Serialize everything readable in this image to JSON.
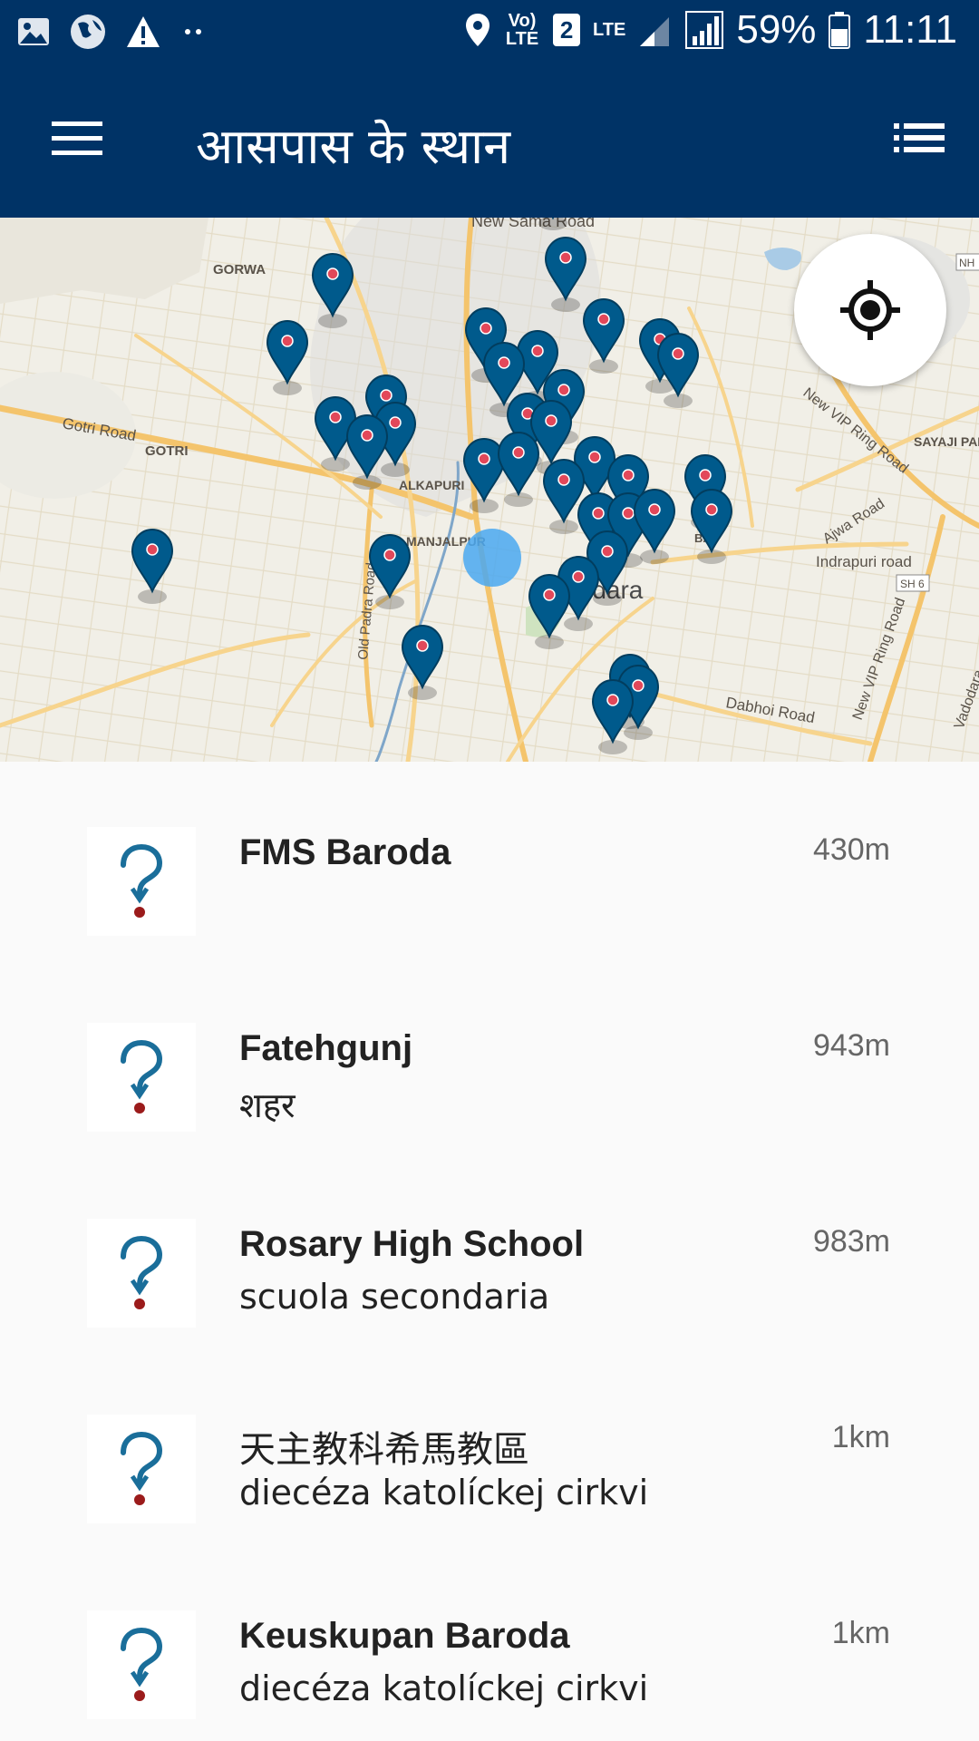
{
  "status_bar": {
    "battery": "59%",
    "time": "11:11",
    "volte": "Vo) LTE",
    "sim": "2",
    "lte": "LTE",
    "notifications": [
      "gallery-icon",
      "globe-icon",
      "warning-icon",
      "more-dots-icon"
    ],
    "indicators": [
      "location-icon",
      "volte-icon",
      "sim2-icon",
      "data-arrows-icon",
      "signal-icon",
      "signal-icon",
      "battery-icon"
    ]
  },
  "app_bar": {
    "title": "आसपास के स्थान",
    "menu_icon": "hamburger-menu-icon",
    "list_icon": "list-view-icon"
  },
  "map": {
    "locate_icon": "my-location-icon",
    "pin_color": "#005a8c",
    "pin_dot_color": "#e2485a",
    "labels": [
      "New Sama Road",
      "GORWA",
      "Gotri Road",
      "GOTRI",
      "ALKAPURI",
      "MANJALPUR",
      "Old Padra Road",
      "Vadodara",
      "New VIP Ring Road",
      "SAYAJI PARK",
      "Ajwa Road",
      "Indrapuri road",
      "SH 6",
      "New VIP Ring Road",
      "Dabhoi Road",
      "Vadodara",
      "NH",
      "BA"
    ]
  },
  "places": [
    {
      "name": "FMS Baroda",
      "description": "",
      "distance": "430m",
      "icon": "unknown-place-question-icon"
    },
    {
      "name": "Fatehgunj",
      "description": "शहर",
      "distance": "943m",
      "icon": "unknown-place-question-icon"
    },
    {
      "name": "Rosary High School",
      "description": "scuola secondaria",
      "distance": "983m",
      "icon": "unknown-place-question-icon"
    },
    {
      "name": "天主教科希馬教區",
      "description": "diecéza katolíckej cirkvi",
      "distance": "1km",
      "icon": "unknown-place-question-icon"
    },
    {
      "name": "Keuskupan Baroda",
      "description": "diecéza katolíckej cirkvi",
      "distance": "1km",
      "icon": "unknown-place-question-icon"
    }
  ],
  "colors": {
    "brand": "#003366",
    "list_bg": "#fafafa",
    "question_blue": "#1a6e9a",
    "question_dot": "#9b1b1b"
  }
}
